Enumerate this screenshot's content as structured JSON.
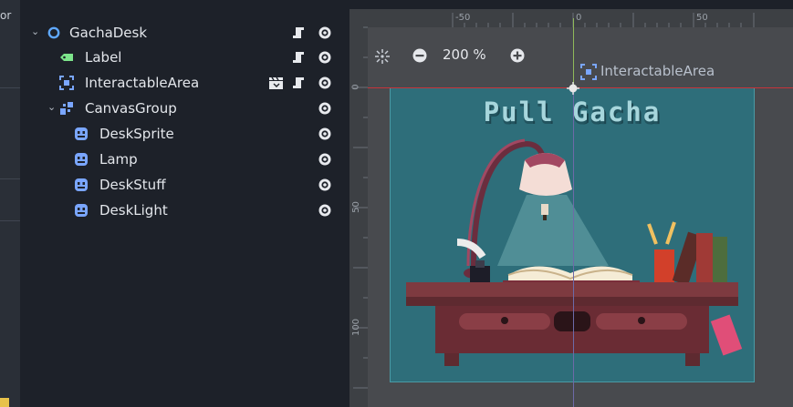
{
  "left_strip": {
    "fragment": "or"
  },
  "scene_tree": {
    "nodes": [
      {
        "name": "GachaDesk",
        "icon": "node2d-circle-icon",
        "expanded": true,
        "color": "#5fa8ff"
      },
      {
        "name": "Label",
        "icon": "label-tag-icon",
        "color": "#7de58b"
      },
      {
        "name": "InteractableArea",
        "icon": "area-select-icon",
        "color": "#7aa6ff"
      },
      {
        "name": "CanvasGroup",
        "icon": "canvas-group-icon",
        "expanded": true,
        "color": "#7aa6ff"
      },
      {
        "name": "DeskSprite",
        "icon": "sprite-icon",
        "color": "#7aa6ff"
      },
      {
        "name": "Lamp",
        "icon": "sprite-icon",
        "color": "#7aa6ff"
      },
      {
        "name": "DeskStuff",
        "icon": "sprite-icon",
        "color": "#7aa6ff"
      },
      {
        "name": "DeskLight",
        "icon": "sprite-icon",
        "color": "#7aa6ff"
      }
    ]
  },
  "viewport": {
    "ruler_top_labels": [
      "-50",
      "0",
      "50"
    ],
    "ruler_left_labels": [
      "0",
      "50",
      "100"
    ],
    "zoom_level": "200 %",
    "selected_node_label": "InteractableArea",
    "canvas_title": "Pull Gacha",
    "colors": {
      "canvas_bg": "#2e6e7a",
      "area_outline": "#4a9aa5",
      "origin_line_x": "#8fb85a",
      "origin_line_y": "#c8343a"
    }
  }
}
